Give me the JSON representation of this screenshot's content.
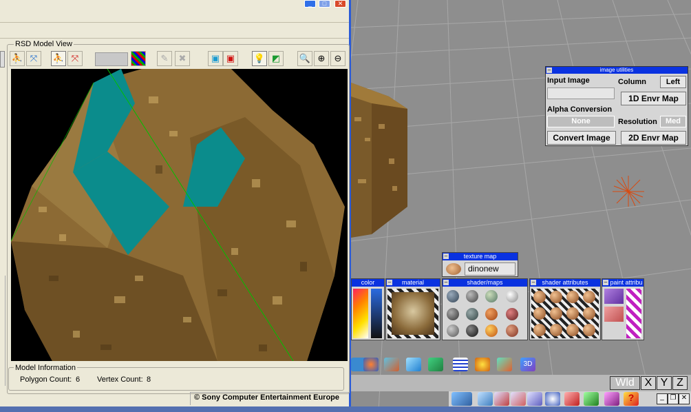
{
  "rsd_window": {
    "group_label": "RSD Model View",
    "model_info_label": "Model Information",
    "polygon_count_label": "Polygon Count:",
    "polygon_count": "6",
    "vertex_count_label": "Vertex Count:",
    "vertex_count": "8",
    "copyright": "© Sony Computer Entertainment Europe"
  },
  "image_utilities": {
    "title": "image utilities",
    "input_image_label": "Input Image",
    "column_label": "Column",
    "column_value": "Left",
    "envr_1d_button": "1D Envr Map",
    "alpha_conversion_label": "Alpha Conversion",
    "alpha_value": "None",
    "resolution_label": "Resolution",
    "resolution_value": "Med",
    "convert_button": "Convert Image",
    "envr_2d_button": "2D Envr Map"
  },
  "panels": {
    "texture_map_title": "texture map",
    "texture_name": "dinonew",
    "color_title": "color",
    "material_title": "material",
    "shader_maps_title": "shader/maps",
    "shader_attributes_title": "shader attributes",
    "paint_attributes_title": "paint attribu"
  },
  "axes": {
    "wld": "Wld",
    "x": "X",
    "y": "Y",
    "z": "Z"
  },
  "colors": {
    "panel_title_blue": "#0a32e0",
    "window_border_blue": "#2a5bd7",
    "window_bg": "#ece9d8",
    "render_bg": "#000000",
    "cutout_teal": "#0b8c8c",
    "axis_line_green": "#00c000"
  }
}
